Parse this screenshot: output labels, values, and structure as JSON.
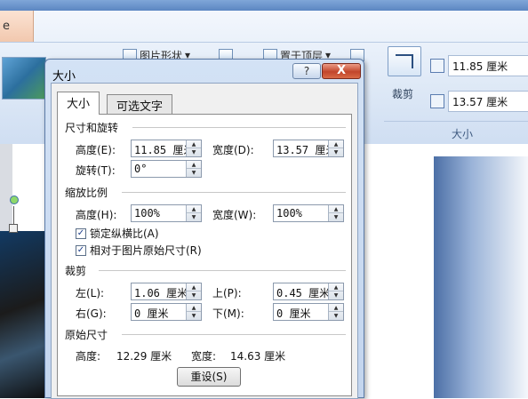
{
  "ribbon": {
    "left_tab_label": "e",
    "picture_shape_label": "图片形状",
    "bring_front_label": "置于顶层",
    "crop_label": "裁剪",
    "height_value": "11.85 厘米",
    "width_value": "13.57 厘米",
    "size_group_label": "大小"
  },
  "dialog": {
    "title": "大小",
    "help_label": "?",
    "close_label": "X",
    "tabs": [
      {
        "label": "大小",
        "active": true
      },
      {
        "label": "可选文字",
        "active": false
      }
    ],
    "size_rotate": {
      "title": "尺寸和旋转",
      "height_label": "高度(E):",
      "height_value": "11.85 厘米",
      "width_label": "宽度(D):",
      "width_value": "13.57 厘米",
      "rotate_label": "旋转(T):",
      "rotate_value": "0°"
    },
    "scale": {
      "title": "缩放比例",
      "height_label": "高度(H):",
      "height_value": "100%",
      "width_label": "宽度(W):",
      "width_value": "100%",
      "lock_aspect_label": "锁定纵横比(A)",
      "lock_aspect_checked": true,
      "relative_label": "相对于图片原始尺寸(R)",
      "relative_checked": true
    },
    "crop": {
      "title": "裁剪",
      "left_label": "左(L):",
      "left_value": "1.06 厘米",
      "top_label": "上(P):",
      "top_value": "0.45 厘米",
      "right_label": "右(G):",
      "right_value": "0 厘米",
      "bottom_label": "下(M):",
      "bottom_value": "0 厘米"
    },
    "original": {
      "title": "原始尺寸",
      "height_label": "高度:",
      "height_value": "12.29 厘米",
      "width_label": "宽度:",
      "width_value": "14.63 厘米",
      "reset_label": "重设(S)"
    }
  }
}
